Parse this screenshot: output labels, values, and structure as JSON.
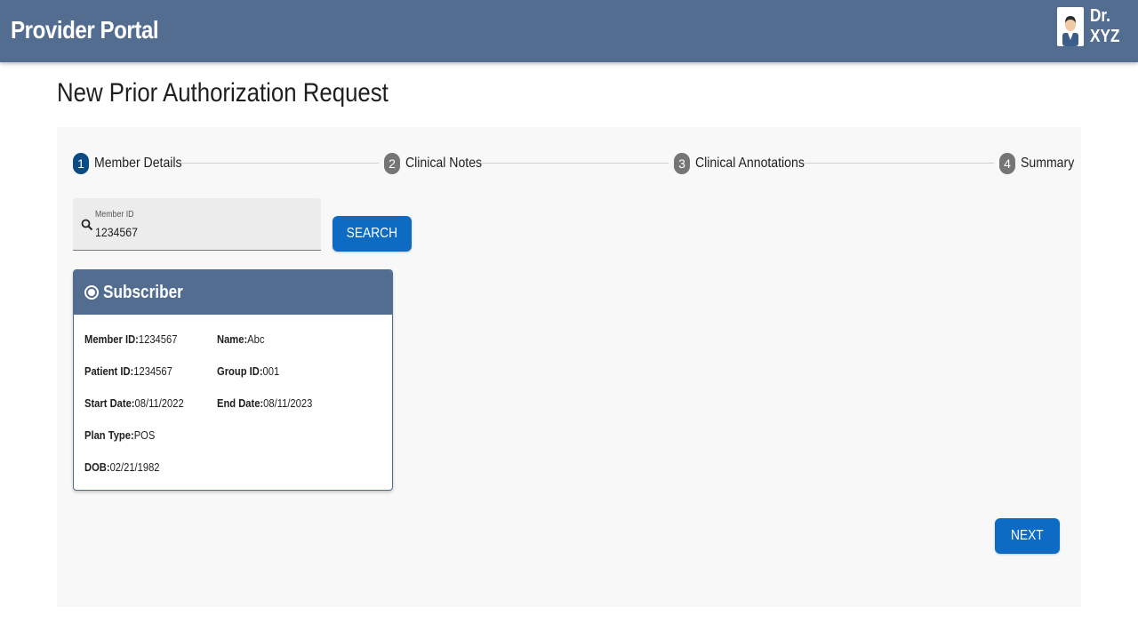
{
  "header": {
    "app_title": "Provider Portal",
    "user_name": "Dr. XYZ",
    "user_avatar_icon": "doctor-avatar-icon",
    "background": "#536d91"
  },
  "page": {
    "title": "New Prior Authorization Request"
  },
  "stepper": {
    "steps": [
      {
        "number": "1",
        "label": "Member Details",
        "active": true
      },
      {
        "number": "2",
        "label": "Clinical Notes",
        "active": false
      },
      {
        "number": "3",
        "label": "Clinical Annotations",
        "active": false
      },
      {
        "number": "4",
        "label": "Summary",
        "active": false
      }
    ],
    "active_color": "#0b4a83",
    "inactive_color": "#757575"
  },
  "search": {
    "label": "Member ID",
    "value": "1234567",
    "icon": "search-icon",
    "button_label": "SEARCH"
  },
  "subscriber": {
    "title": "Subscriber",
    "selected": true,
    "fields": {
      "member_id_label": "Member ID:",
      "member_id_value": "1234567",
      "name_label": "Name:",
      "name_value": "Abc",
      "patient_id_label": "Patient ID:",
      "patient_id_value": "1234567",
      "group_id_label": "Group ID:",
      "group_id_value": "001",
      "start_date_label": "Start Date:",
      "start_date_value": "08/11/2022",
      "end_date_label": "End Date:",
      "end_date_value": "08/11/2023",
      "plan_type_label": "Plan Type:",
      "plan_type_value": "POS",
      "dob_label": "DOB:",
      "dob_value": "02/21/1982"
    }
  },
  "actions": {
    "next_label": "NEXT",
    "button_color": "#0d6bc4"
  }
}
